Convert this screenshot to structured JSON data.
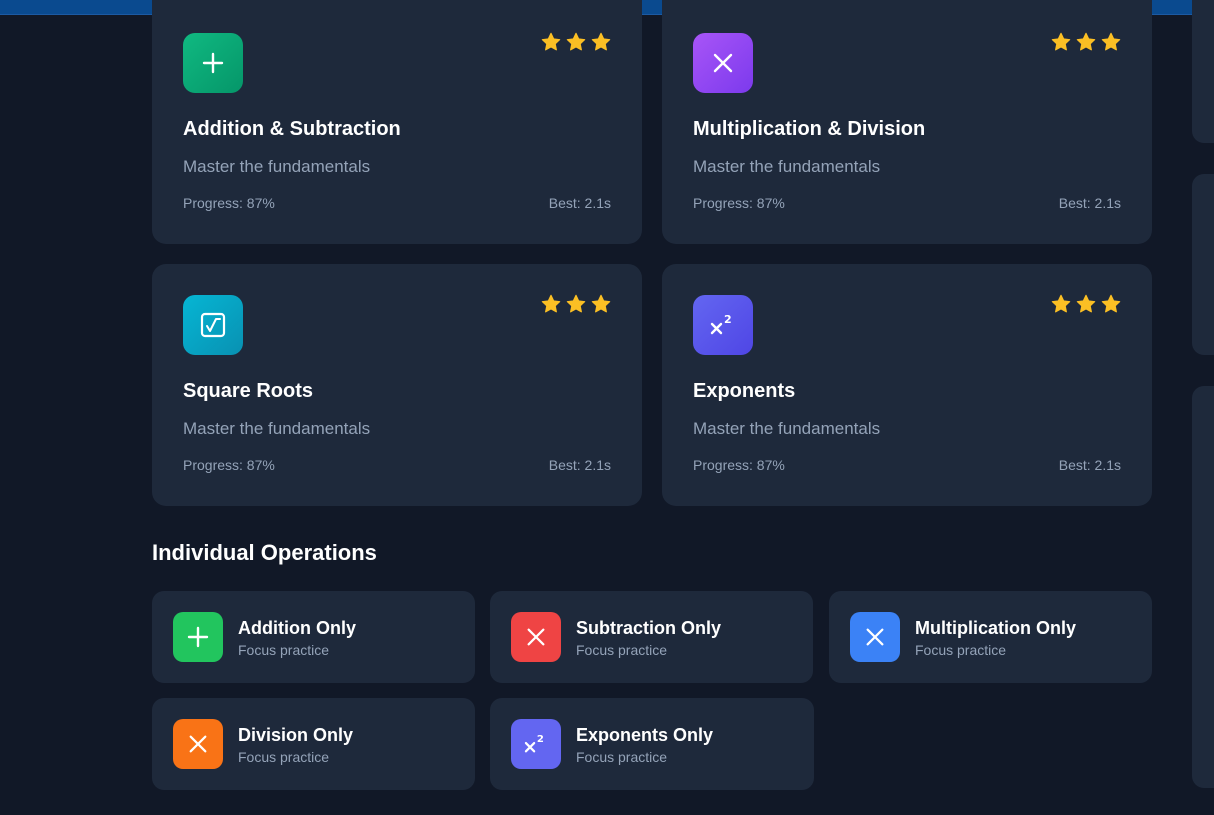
{
  "topic_cards": [
    {
      "title": "Addition & Subtraction",
      "subtitle": "Master the fundamentals",
      "progress": "Progress: 87%",
      "best": "Best: 2.1s",
      "stars": 3,
      "icon": "plus-icon",
      "icon_gradient": [
        "#10b981",
        "#059669"
      ]
    },
    {
      "title": "Multiplication & Division",
      "subtitle": "Master the fundamentals",
      "progress": "Progress: 87%",
      "best": "Best: 2.1s",
      "stars": 3,
      "icon": "times-icon",
      "icon_gradient": [
        "#a855f7",
        "#7c3aed"
      ]
    },
    {
      "title": "Square Roots",
      "subtitle": "Master the fundamentals",
      "progress": "Progress: 87%",
      "best": "Best: 2.1s",
      "stars": 3,
      "icon": "square-root-icon",
      "icon_gradient": [
        "#06b6d4",
        "#0891b2"
      ]
    },
    {
      "title": "Exponents",
      "subtitle": "Master the fundamentals",
      "progress": "Progress: 87%",
      "best": "Best: 2.1s",
      "stars": 3,
      "icon": "exponent-icon",
      "icon_gradient": [
        "#6366f1",
        "#4f46e5"
      ]
    }
  ],
  "section": {
    "title": "Individual Operations"
  },
  "operations": [
    {
      "title": "Addition Only",
      "subtitle": "Focus practice",
      "icon": "plus-icon",
      "color": "#22c55e"
    },
    {
      "title": "Subtraction Only",
      "subtitle": "Focus practice",
      "icon": "times-icon",
      "color": "#ef4444"
    },
    {
      "title": "Multiplication Only",
      "subtitle": "Focus practice",
      "icon": "times-icon",
      "color": "#3b82f6"
    },
    {
      "title": "Division Only",
      "subtitle": "Focus practice",
      "icon": "times-icon",
      "color": "#f97316"
    },
    {
      "title": "Exponents Only",
      "subtitle": "Focus practice",
      "icon": "exponent-icon",
      "color": "#6366f1"
    }
  ],
  "colors": {
    "background": "#111827",
    "card": "#1e293b",
    "muted_text": "#94a3b8",
    "star": "#fbbf24",
    "topbar": "#0a4a8f"
  }
}
